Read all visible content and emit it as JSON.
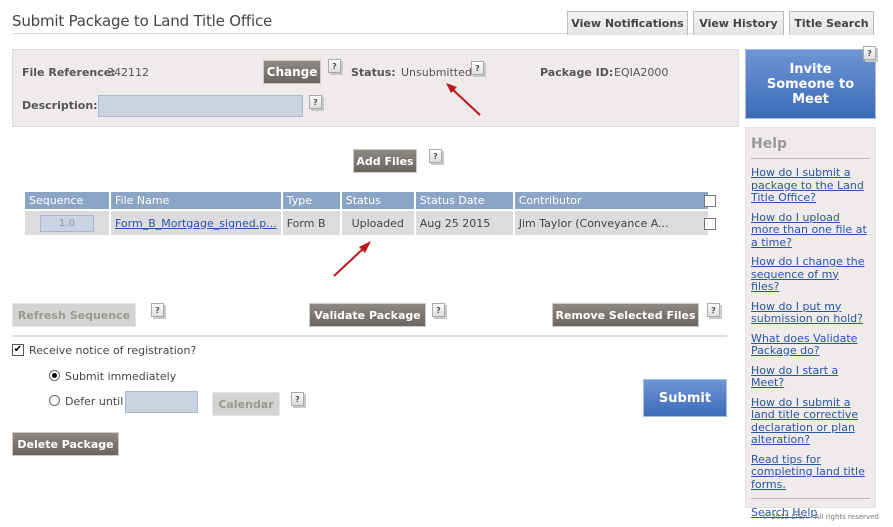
{
  "header": {
    "title": "Submit Package to Land Title Office",
    "tabs": [
      {
        "label": "View Notifications"
      },
      {
        "label": "View History"
      },
      {
        "label": "Title Search"
      }
    ]
  },
  "info": {
    "file_reference_label": "File Reference:",
    "file_reference_value": "342112",
    "change_label": "Change",
    "status_label": "Status:",
    "status_value": "Unsubmitted",
    "package_id_label": "Package ID:",
    "package_id_value": "EQIA2000",
    "description_label": "Description:",
    "description_value": "",
    "help_glyph": "?"
  },
  "actions": {
    "add_files": "Add Files",
    "refresh_sequence": "Refresh Sequence",
    "validate_package": "Validate Package",
    "remove_selected_files": "Remove Selected Files",
    "submit": "Submit",
    "delete_package": "Delete Package",
    "calendar": "Calendar"
  },
  "table": {
    "columns": [
      "Sequence",
      "File Name",
      "Type",
      "Status",
      "Status Date",
      "Contributor"
    ],
    "rows": [
      {
        "sequence": "1.0",
        "file_name": "Form_B_Mortgage_signed.p...",
        "type": "Form B",
        "status": "Uploaded",
        "status_date": "Aug 25 2015",
        "contributor": "Jim Taylor (Conveyance A...",
        "selected": false
      }
    ]
  },
  "options": {
    "receive_notice_label": "Receive notice of registration?",
    "receive_notice_checked": true,
    "submit_immediately_label": "Submit immediately",
    "submit_immediately_selected": true,
    "defer_until_label": "Defer until",
    "defer_until_value": ""
  },
  "sidebar": {
    "invite_label": "Invite Someone to Meet",
    "help_title": "Help",
    "help_links": [
      "How do I submit a package to the Land Title Office?",
      "How do I upload more than one file at a time?",
      "How do I change the sequence of my files?",
      "How do I put my submission on hold?",
      "What does Validate Package do?",
      "How do I start a Meet?",
      "How do I submit a land title corrective declaration or plan alteration?",
      "Read tips for completing land title forms."
    ],
    "search_help": "Search Help"
  },
  "footer": {
    "copyright": "© 2015 LTSA - All rights reserved"
  },
  "colors": {
    "accent_blue": "#3d6bb8",
    "table_header": "#8aa5c6",
    "dark_button": "#7a746e",
    "annotation_arrow": "#c0161b"
  }
}
